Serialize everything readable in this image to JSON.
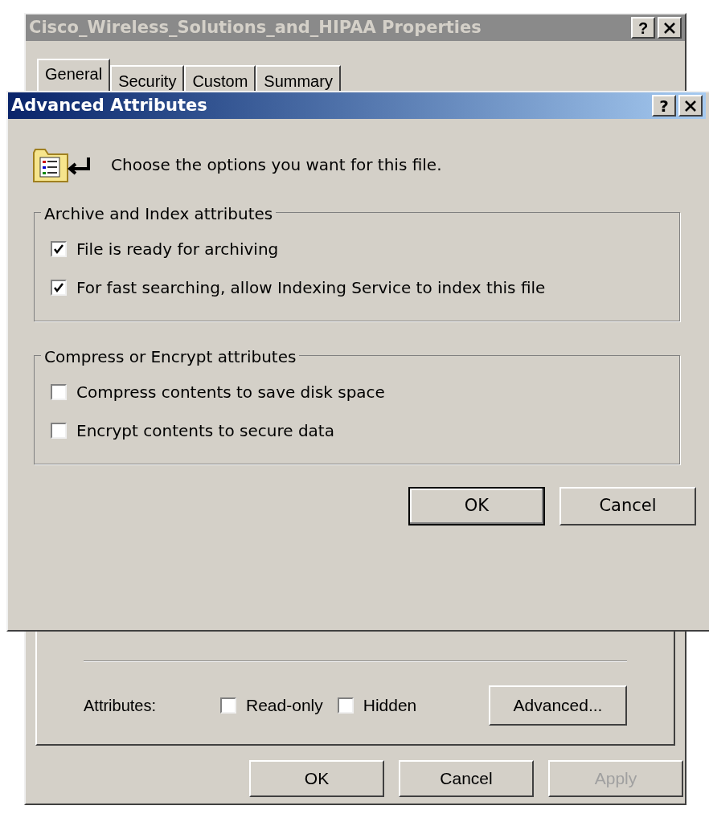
{
  "properties_window": {
    "title": "Cisco_Wireless_Solutions_and_HIPAA Properties",
    "active": false,
    "help": "?",
    "tabs": [
      {
        "label": "General",
        "selected": true
      },
      {
        "label": "Security",
        "selected": false
      },
      {
        "label": "Custom",
        "selected": false
      },
      {
        "label": "Summary",
        "selected": false
      }
    ],
    "attributes": {
      "label": "Attributes:",
      "checkboxes": [
        {
          "label": "Read-only",
          "checked": false
        },
        {
          "label": "Hidden",
          "checked": false
        }
      ],
      "button": "Advanced..."
    },
    "buttons": [
      {
        "label": "OK",
        "disabled": false,
        "default": false
      },
      {
        "label": "Cancel",
        "disabled": false,
        "default": false
      },
      {
        "label": "Apply",
        "disabled": true,
        "default": false
      }
    ]
  },
  "advanced_dialog": {
    "title": "Advanced Attributes",
    "active": true,
    "help": "?",
    "prompt": "Choose the options you want for this file.",
    "groups": [
      {
        "title": "Archive and Index attributes",
        "options": [
          {
            "label": "File is ready for archiving",
            "checked": true
          },
          {
            "label": "For fast searching, allow Indexing Service to index this file",
            "checked": true
          }
        ]
      },
      {
        "title": "Compress or Encrypt attributes",
        "options": [
          {
            "label": "Compress contents to save disk space",
            "checked": false
          },
          {
            "label": "Encrypt contents to secure data",
            "checked": false
          }
        ]
      }
    ],
    "buttons": [
      {
        "label": "OK",
        "disabled": false,
        "default": true
      },
      {
        "label": "Cancel",
        "disabled": false,
        "default": false
      }
    ]
  }
}
